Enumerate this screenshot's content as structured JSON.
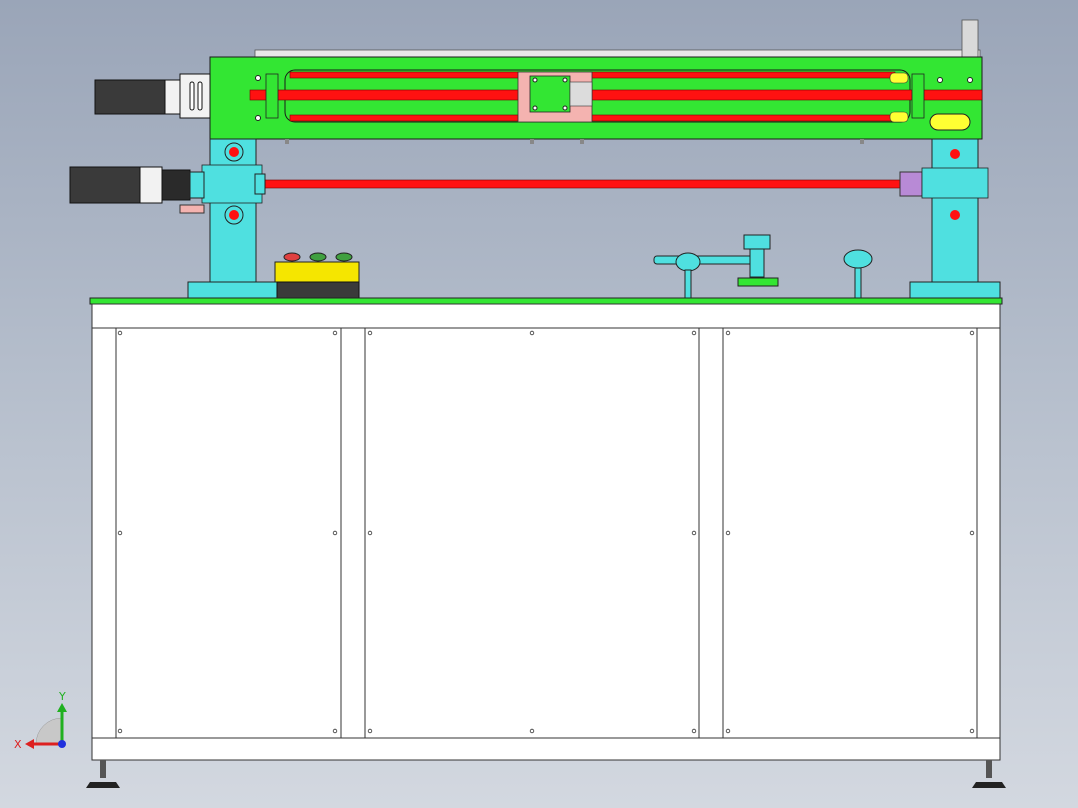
{
  "viewport": {
    "background_top": "#9aa5b8",
    "background_bottom": "#d3d8e0"
  },
  "colors": {
    "frame_plate": "#33e633",
    "rod": "#ff1111",
    "support": "#4fe0e0",
    "carriage": "#f4b3b0",
    "motor_body": "#3a3a3a",
    "motor_cap": "#f2f2f2",
    "control_box": "#f5e600",
    "cabinet": "#ffffff",
    "indicator_yellow": "#ffff33"
  },
  "triad": {
    "x_label": "X",
    "y_label": "Y",
    "x_color": "#dd2020",
    "y_color": "#20b020",
    "z_color": "#2030dd"
  },
  "icons": [
    "coordinate-triad-icon",
    "leveling-foot-icon"
  ]
}
